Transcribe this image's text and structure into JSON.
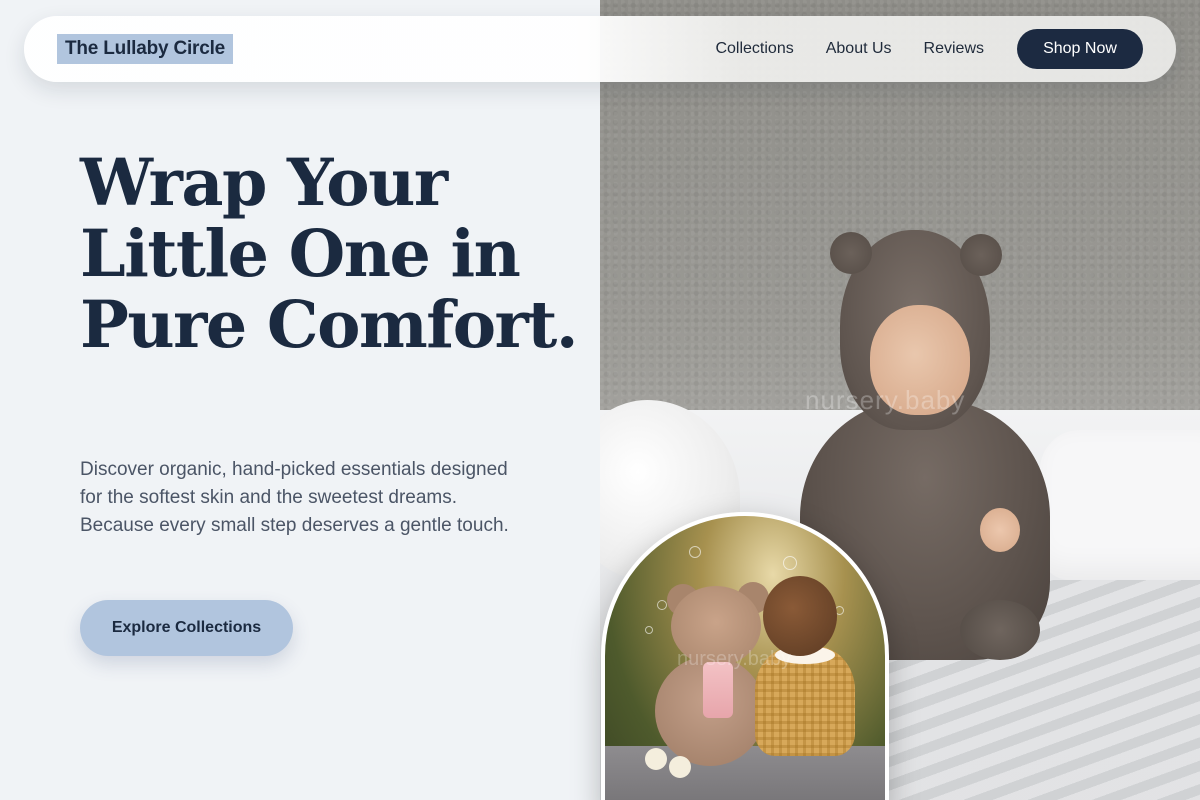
{
  "nav": {
    "brand": "The Lullaby Circle",
    "links": [
      "Collections",
      "About Us",
      "Reviews"
    ],
    "shop_label": "Shop Now"
  },
  "hero": {
    "headline": "Wrap Your Little One in Pure Comfort.",
    "subtext": "Discover organic, hand-picked essentials designed for the softest skin and the sweetest dreams. Because every small step deserves a gentle touch.",
    "cta_label": "Explore Collections"
  },
  "images": {
    "main_watermark": "nursery.baby",
    "inset_watermark": "nursery.baby"
  },
  "colors": {
    "background": "#f0f3f6",
    "navy": "#1c2a41",
    "accent_blue": "#b1c5de",
    "body_text": "#4b5566"
  }
}
